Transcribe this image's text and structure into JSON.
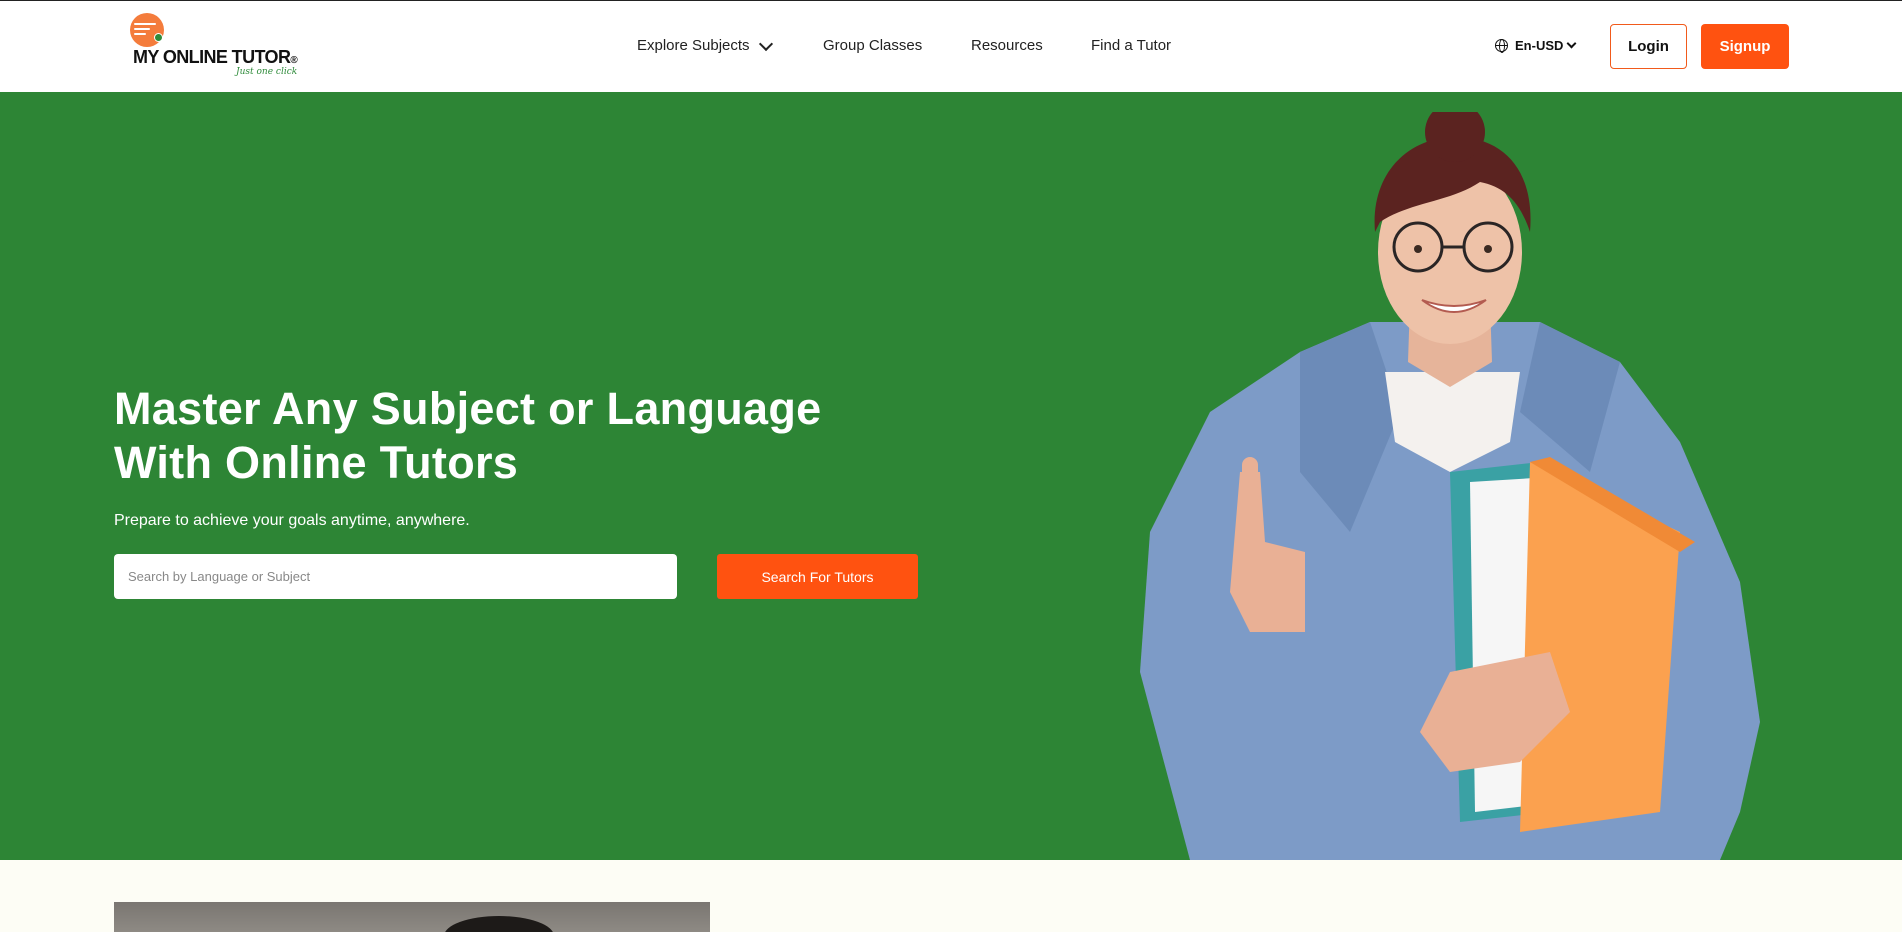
{
  "brand": {
    "name": "MY ONLINE TUTOR",
    "registered": "®",
    "tagline": "Just one click"
  },
  "nav": {
    "explore_subjects": "Explore Subjects",
    "group_classes": "Group Classes",
    "resources": "Resources",
    "find_tutor": "Find a Tutor"
  },
  "header": {
    "language": "En-USD",
    "login_label": "Login",
    "signup_label": "Signup"
  },
  "hero": {
    "title": "Master Any Subject or Language With Online Tutors",
    "subtitle": "Prepare to achieve your goals anytime, anywhere.",
    "search_placeholder": "Search by Language or Subject",
    "search_value": "",
    "search_button": "Search For Tutors"
  },
  "icons": {
    "explore_chevron": "chevron-down-icon",
    "language": "globe-icon",
    "language_chevron": "chevron-down-icon"
  },
  "colors": {
    "accent": "#ff5210",
    "hero_bg": "#2d8535",
    "page_bg": "#fdfdf5",
    "logo_orange": "#f47c3c",
    "logo_green": "#2e8b3a"
  }
}
